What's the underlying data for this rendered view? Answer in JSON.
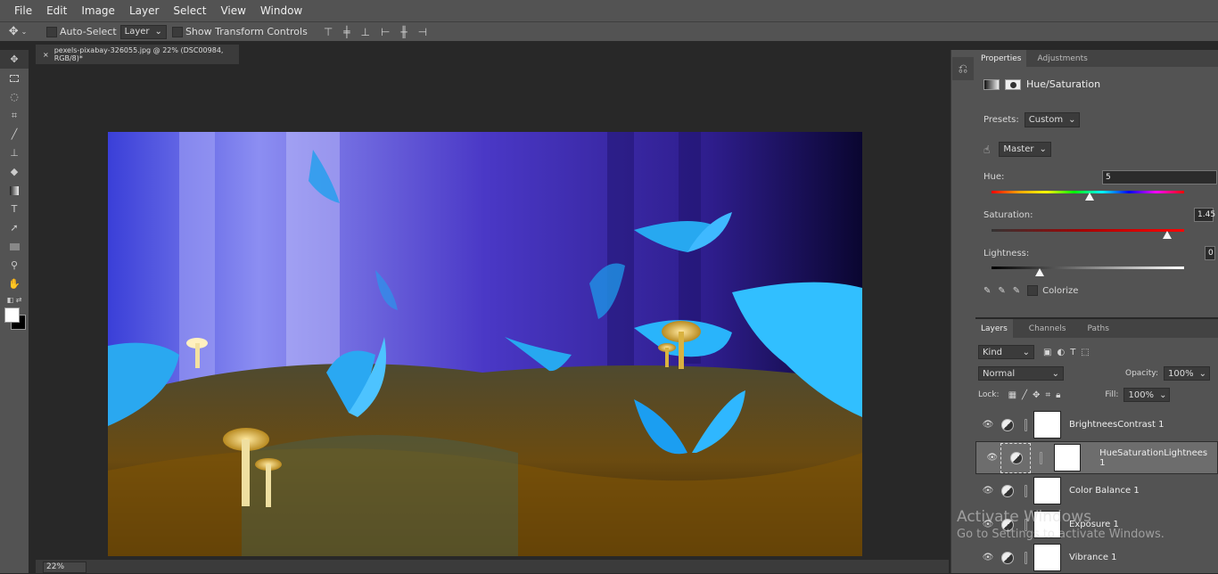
{
  "menu": [
    "File",
    "Edit",
    "Image",
    "Layer",
    "Select",
    "View",
    "Window"
  ],
  "options": {
    "auto_select": "Auto-Select",
    "auto_select_target": "Layer",
    "show_transform": "Show Transform Controls"
  },
  "document": {
    "tab_title": "pexels-pixabay-326055.jpg @ 22% (DSC00984, RGB/8)*",
    "zoom": "22%"
  },
  "properties": {
    "tabs": [
      "Properties",
      "Adjustments"
    ],
    "adjustment_title": "Hue/Saturation",
    "presets_label": "Presets:",
    "presets_value": "Custom",
    "channel_value": "Master",
    "hue_label": "Hue:",
    "hue_value": "5",
    "hue_position": 0.51,
    "saturation_label": "Saturation:",
    "saturation_value": "1.45",
    "saturation_position": 0.91,
    "lightness_label": "Lightness:",
    "lightness_value": "0",
    "lightness_position": 0.25,
    "colorize_label": "Colorize"
  },
  "layers_panel": {
    "tabs": [
      "Layers",
      "Channels",
      "Paths"
    ],
    "kind_value": "Kind",
    "blend_mode": "Normal",
    "opacity_label": "Opacity:",
    "opacity_value": "100%",
    "lock_label": "Lock:",
    "fill_label": "Fill:",
    "fill_value": "100%",
    "layers": [
      {
        "name": "BrightneesContrast 1",
        "selected": false
      },
      {
        "name": "HueSaturationLightnees 1",
        "selected": true
      },
      {
        "name": "Color Balance 1",
        "selected": false
      },
      {
        "name": "Exposure 1",
        "selected": false
      },
      {
        "name": "Vibrance 1",
        "selected": false
      }
    ]
  },
  "watermark": {
    "line1": "Activate Windows",
    "line2": "Go to Settings to activate Windows."
  }
}
